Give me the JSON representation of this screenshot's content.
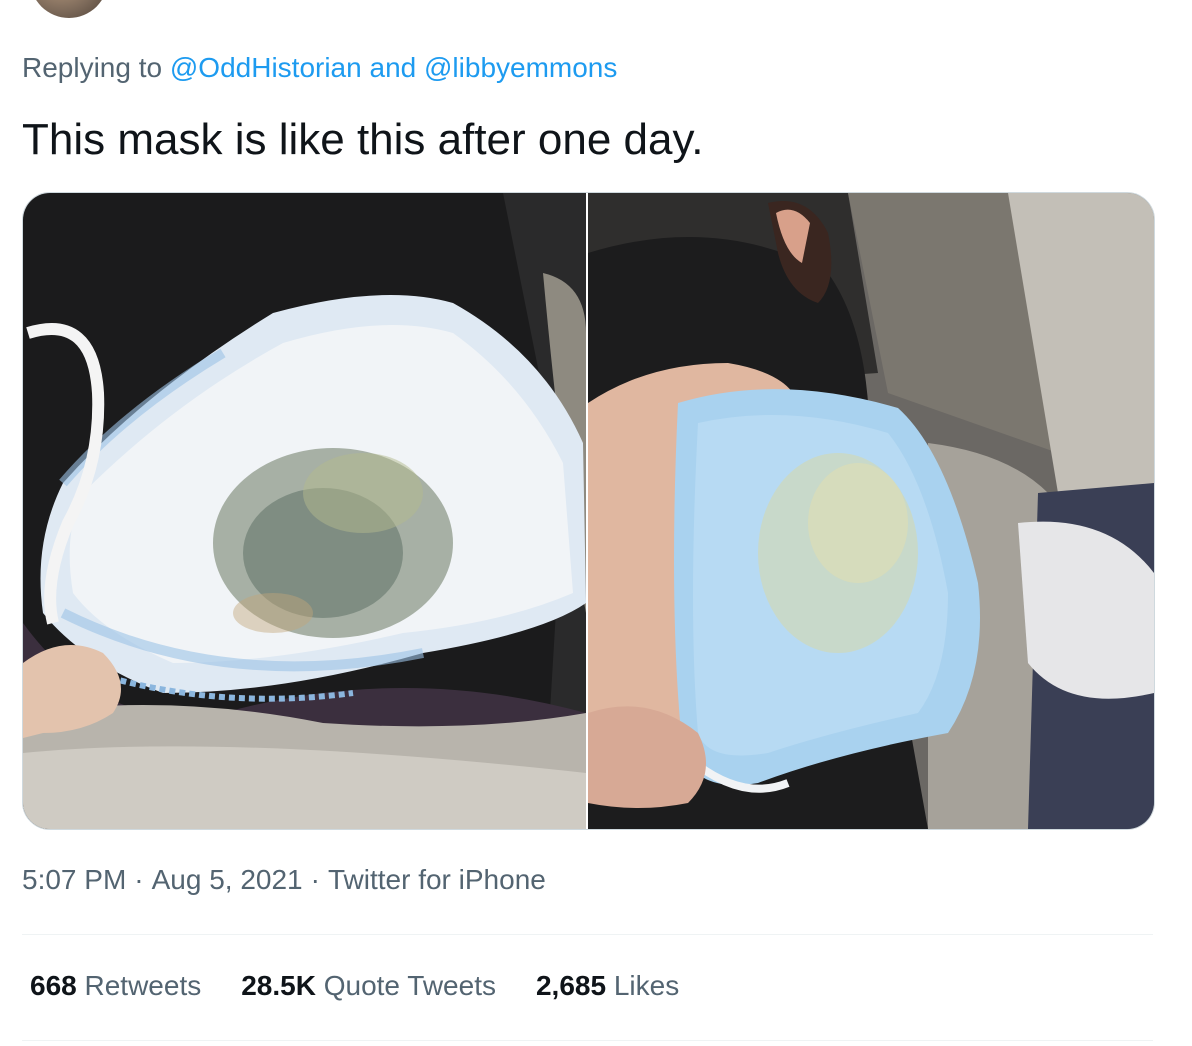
{
  "reply": {
    "prefix": "Replying to",
    "handle1": "@OddHistorian",
    "conjunction": "and",
    "handle2": "@libbyemmons"
  },
  "tweet": {
    "text": "This mask is like this after one day."
  },
  "meta": {
    "time": "5:07 PM",
    "date": "Aug 5, 2021",
    "source": "Twitter for iPhone"
  },
  "stats": {
    "retweets_count": "668",
    "retweets_label": "Retweets",
    "quotes_count": "28.5K",
    "quotes_label": "Quote Tweets",
    "likes_count": "2,685",
    "likes_label": "Likes"
  },
  "colors": {
    "link": "#1d9bf0",
    "secondary_text": "#536471",
    "primary_text": "#0f1419",
    "border": "#cfd9de"
  }
}
